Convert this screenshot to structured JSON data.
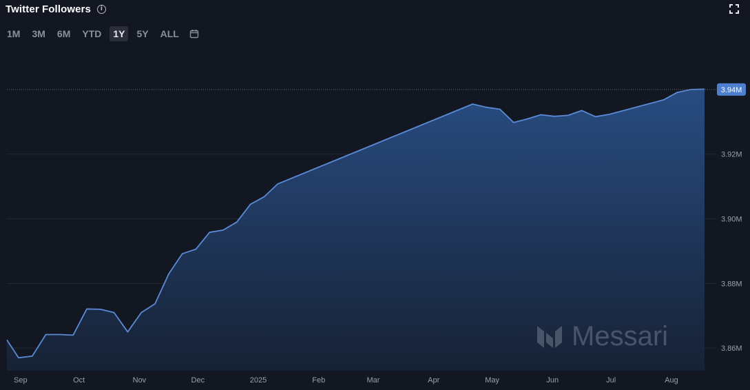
{
  "header": {
    "title": "Twitter Followers",
    "info_icon": "info-icon",
    "expand_icon": "fullscreen-icon"
  },
  "ranges": [
    {
      "label": "1M",
      "active": false
    },
    {
      "label": "3M",
      "active": false
    },
    {
      "label": "6M",
      "active": false
    },
    {
      "label": "YTD",
      "active": false
    },
    {
      "label": "1Y",
      "active": true
    },
    {
      "label": "5Y",
      "active": false
    },
    {
      "label": "ALL",
      "active": false
    }
  ],
  "calendar_icon": "calendar-icon",
  "watermark": {
    "text": "Messari",
    "icon": "messari-logo-icon"
  },
  "colors": {
    "background": "#131722",
    "line": "#5b8bd6",
    "fill_top": "#294f86",
    "fill_bottom": "#172236",
    "last_value_badge": "#4e7fcf"
  },
  "chart_data": {
    "type": "area",
    "title": "Twitter Followers",
    "xlabel": "",
    "ylabel": "",
    "x_tick_labels": [
      "Sep",
      "Oct",
      "Nov",
      "Dec",
      "2025",
      "Feb",
      "Mar",
      "Apr",
      "May",
      "Jun",
      "Jul",
      "Aug"
    ],
    "y_tick_labels": [
      "3.86M",
      "3.88M",
      "3.90M",
      "3.92M"
    ],
    "y_ticks": [
      3.86,
      3.88,
      3.9,
      3.92
    ],
    "ylim": [
      3.853,
      3.9485
    ],
    "grid": true,
    "last_value_label": "3.94M",
    "last_value": 3.94,
    "series": [
      {
        "values": [
          [
            "2024-08-25",
            3.8625
          ],
          [
            "2024-08-31",
            3.857
          ],
          [
            "2024-09-07",
            3.8575
          ],
          [
            "2024-09-14",
            3.8642
          ],
          [
            "2024-09-21",
            3.8642
          ],
          [
            "2024-09-28",
            3.864
          ],
          [
            "2024-10-05",
            3.8721
          ],
          [
            "2024-10-12",
            3.872
          ],
          [
            "2024-10-19",
            3.871
          ],
          [
            "2024-10-26",
            3.865
          ],
          [
            "2024-11-02",
            3.871
          ],
          [
            "2024-11-09",
            3.8737
          ],
          [
            "2024-11-16",
            3.8829
          ],
          [
            "2024-11-23",
            3.8892
          ],
          [
            "2024-11-30",
            3.8906
          ],
          [
            "2024-12-07",
            3.8958
          ],
          [
            "2024-12-14",
            3.8965
          ],
          [
            "2024-12-21",
            3.899
          ],
          [
            "2024-12-28",
            3.9045
          ],
          [
            "2025-01-04",
            3.9068
          ],
          [
            "2025-01-11",
            3.9108
          ],
          [
            "2025-04-21",
            3.9355
          ],
          [
            "2025-04-28",
            3.9345
          ],
          [
            "2025-05-05",
            3.9339
          ],
          [
            "2025-05-12",
            3.9298
          ],
          [
            "2025-05-19",
            3.9309
          ],
          [
            "2025-05-26",
            3.9322
          ],
          [
            "2025-06-02",
            3.9317
          ],
          [
            "2025-06-09",
            3.932
          ],
          [
            "2025-06-16",
            3.9335
          ],
          [
            "2025-06-23",
            3.9316
          ],
          [
            "2025-06-30",
            3.9323
          ],
          [
            "2025-07-28",
            3.9368
          ],
          [
            "2025-08-04",
            3.9391
          ],
          [
            "2025-08-11",
            3.94
          ],
          [
            "2025-08-18",
            3.9401
          ]
        ]
      }
    ]
  }
}
